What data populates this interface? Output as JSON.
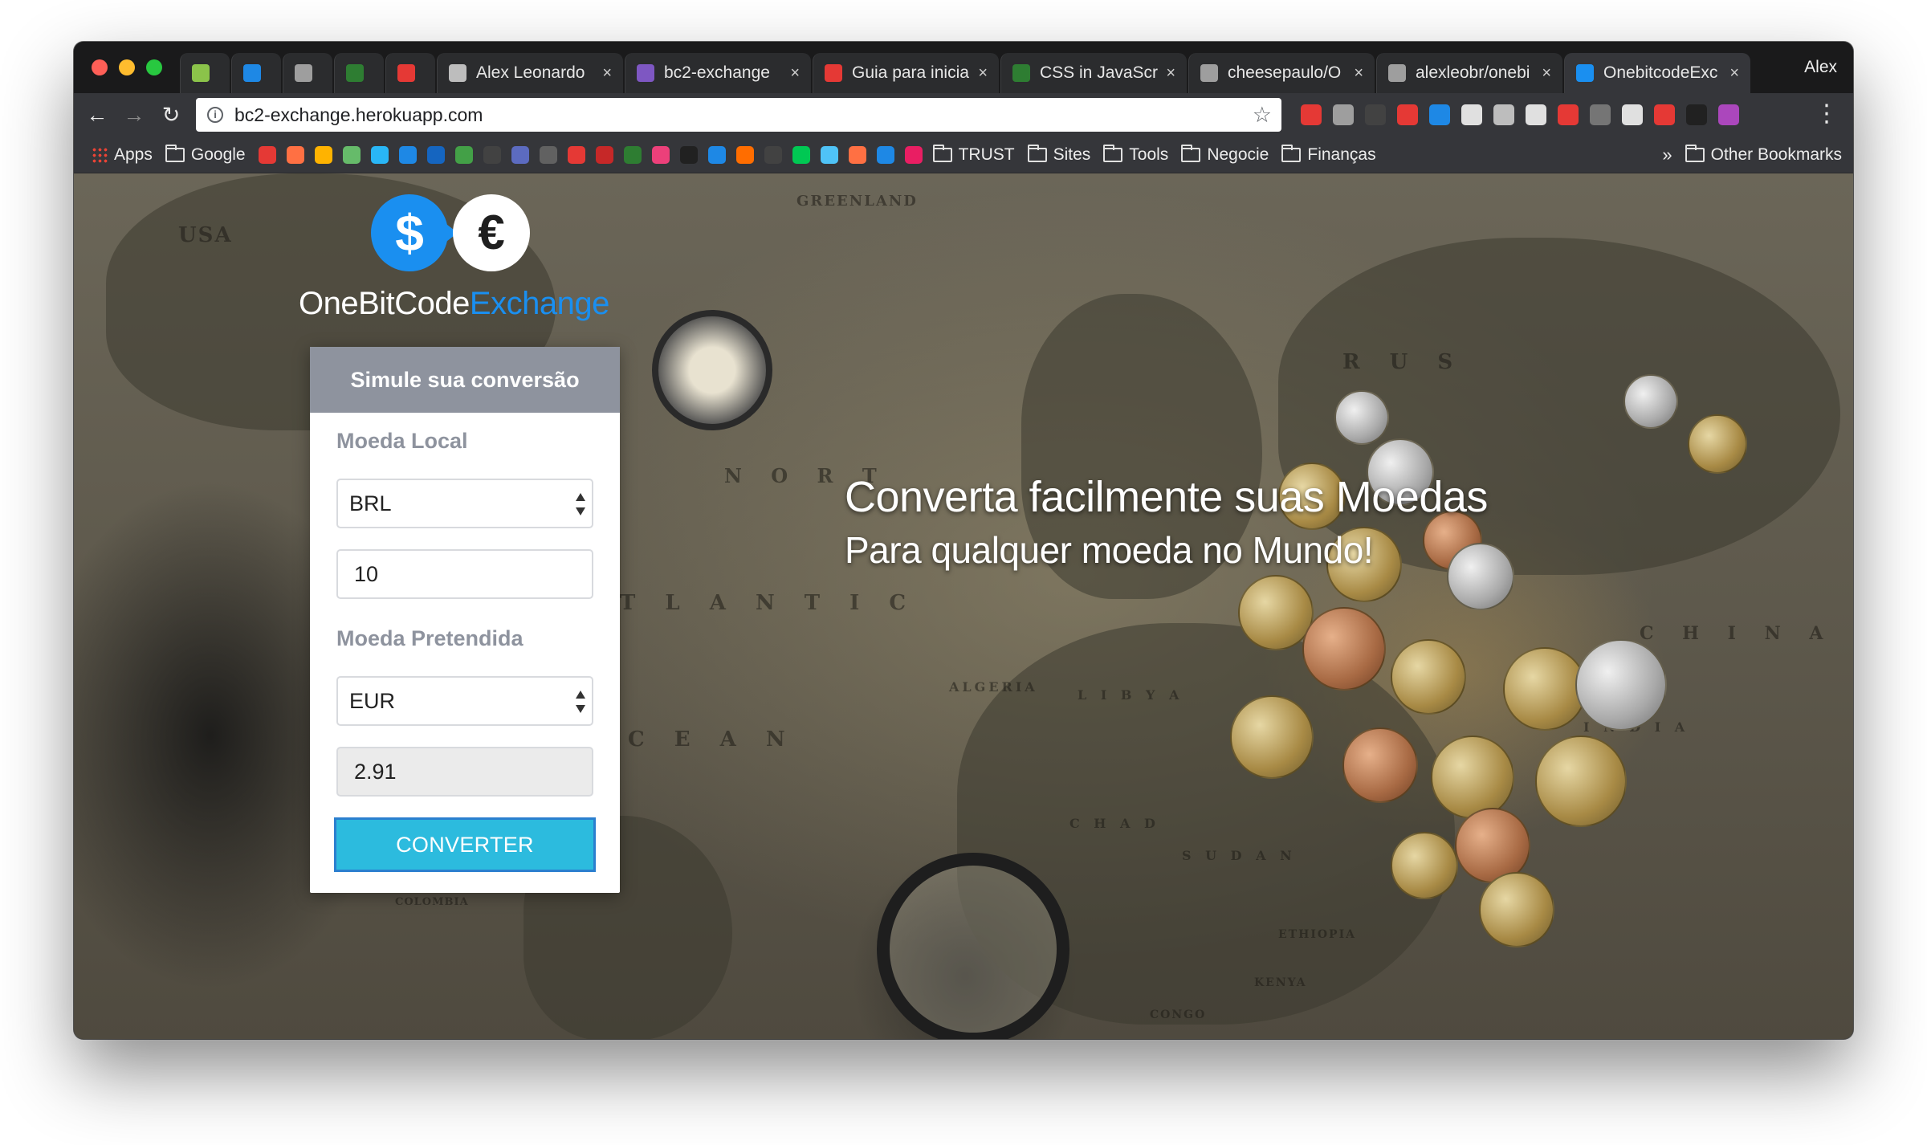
{
  "browser": {
    "tabs": [
      {
        "title": "",
        "favicon_color": "#8bc34a",
        "pinned": true
      },
      {
        "title": "",
        "favicon_color": "#1e88e5",
        "pinned": true
      },
      {
        "title": "",
        "favicon_color": "#9e9e9e",
        "pinned": true
      },
      {
        "title": "",
        "favicon_color": "#2e7d32",
        "pinned": true
      },
      {
        "title": "",
        "favicon_color": "#e53935",
        "pinned": true
      },
      {
        "title": "Alex Leonardo",
        "favicon_color": "#bdbdbd",
        "close": "×"
      },
      {
        "title": "bc2-exchange",
        "favicon_color": "#7e57c2",
        "close": "×"
      },
      {
        "title": "Guia para inicia",
        "favicon_color": "#e53935",
        "close": "×"
      },
      {
        "title": "CSS in JavaScri",
        "favicon_color": "#2e7d32",
        "close": "×"
      },
      {
        "title": "cheesepaulo/O",
        "favicon_color": "#9e9e9e",
        "close": "×"
      },
      {
        "title": "alexleobr/onebi",
        "favicon_color": "#9e9e9e",
        "close": "×"
      },
      {
        "title": "OnebitcodeExc",
        "favicon_color": "#1a8ff0",
        "close": "×",
        "active": true
      }
    ],
    "profile_name": "Alex",
    "url": "bc2-exchange.herokuapp.com",
    "extensions_colors": [
      "#e53935",
      "#9e9e9e",
      "#424242",
      "#e53935",
      "#1e88e5",
      "#e0e0e0",
      "#bdbdbd",
      "#e0e0e0",
      "#e53935",
      "#757575",
      "#e0e0e0",
      "#e53935",
      "#212121",
      "#ab47bc"
    ],
    "bookmarks": {
      "apps": "Apps",
      "google": "Google",
      "icon_colors": [
        "#e53935",
        "#ff7043",
        "#ffb300",
        "#66bb6a",
        "#29b6f6",
        "#1e88e5",
        "#1565c0",
        "#43a047",
        "#424242",
        "#5c6bc0",
        "#616161",
        "#e53935",
        "#c62828",
        "#2e7d32",
        "#ec407a",
        "#212121",
        "#1e88e5",
        "#ff6d00",
        "#424242",
        "#00c853",
        "#4fc3f7",
        "#ff7043",
        "#1e88e5",
        "#e91e63"
      ],
      "folders": [
        "TRUST",
        "Sites",
        "Tools",
        "Negocie",
        "Finanças"
      ],
      "more": "»",
      "other": "Other Bookmarks"
    }
  },
  "page": {
    "logo": {
      "dollar": "$",
      "euro": "€",
      "name_primary": "OneBitCode",
      "name_accent": "Exchange",
      "accent_color": "#1a8ff0"
    },
    "form": {
      "header": "Simule sua conversão",
      "local_label": "Moeda Local",
      "local_currency": "BRL",
      "amount": "10",
      "target_label": "Moeda Pretendida",
      "target_currency": "EUR",
      "result": "2.91",
      "convert_label": "CONVERTER",
      "button_color": "#2cbbde"
    },
    "hero": {
      "title": "Converta facilmente suas Moedas",
      "subtitle": "Para qualquer moeda no Mundo!"
    },
    "map_labels": [
      "USA",
      "GREENLAND",
      "R U S",
      "C H I N A",
      "N O R T",
      "T L A N T I C",
      "C E A N",
      "ALGERIA",
      "L I B Y A",
      "C H A D",
      "S U D A N",
      "ETHIOPIA",
      "KENYA",
      "CONGO",
      "COLOMBIA",
      "I N D I A"
    ]
  }
}
